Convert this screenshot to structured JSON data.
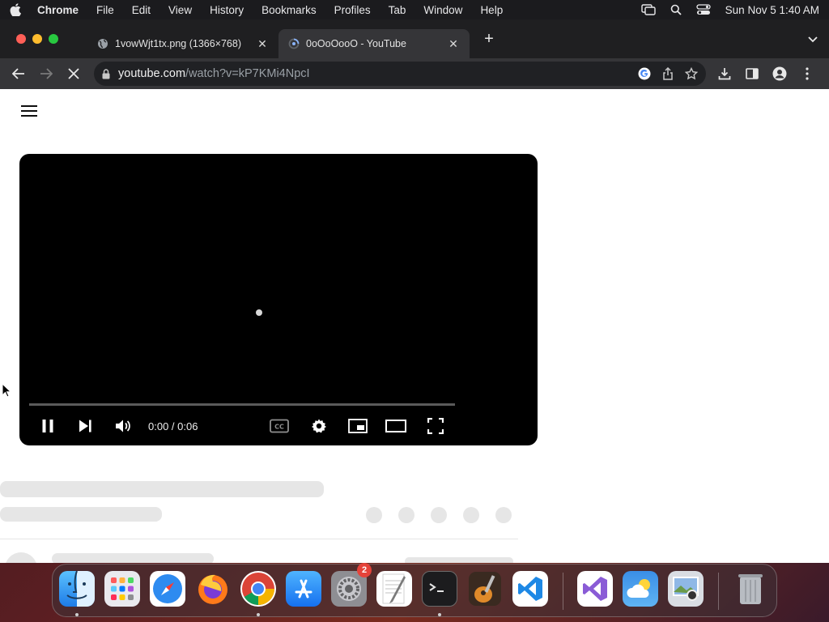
{
  "menubar": {
    "app_name": "Chrome",
    "items": [
      "File",
      "Edit",
      "View",
      "History",
      "Bookmarks",
      "Profiles",
      "Tab",
      "Window",
      "Help"
    ],
    "clock": "Sun Nov 5  1:40 AM"
  },
  "tabs": [
    {
      "title": "1vowWjt1tx.png (1366×768)",
      "active": false
    },
    {
      "title": "0oOoOooO - YouTube",
      "active": true
    }
  ],
  "omnibox": {
    "host": "youtube.com",
    "path": "/watch?v=kP7KMi4NpcI"
  },
  "player": {
    "time": "0:00 / 0:06",
    "progress_fraction": 0
  },
  "dock": {
    "apps": [
      {
        "name": "Finder",
        "running": true
      },
      {
        "name": "Launchpad",
        "running": false
      },
      {
        "name": "Safari",
        "running": false
      },
      {
        "name": "Firefox",
        "running": false
      },
      {
        "name": "Chrome",
        "running": true
      },
      {
        "name": "App Store",
        "running": false
      },
      {
        "name": "System Settings",
        "running": false,
        "badge": "2"
      },
      {
        "name": "TextEdit",
        "running": false
      },
      {
        "name": "Terminal",
        "running": true
      },
      {
        "name": "GarageBand",
        "running": false
      },
      {
        "name": "Visual Studio Code",
        "running": false
      },
      {
        "name": "Visual Studio",
        "running": false
      },
      {
        "name": "Weather",
        "running": false
      },
      {
        "name": "Preview",
        "running": false
      },
      {
        "name": "Trash",
        "running": false
      }
    ]
  },
  "colors": {
    "close": "#ff5f57",
    "minimize": "#febc2e",
    "zoom": "#28c840",
    "tab_active": "#353538",
    "player": "#000000"
  }
}
